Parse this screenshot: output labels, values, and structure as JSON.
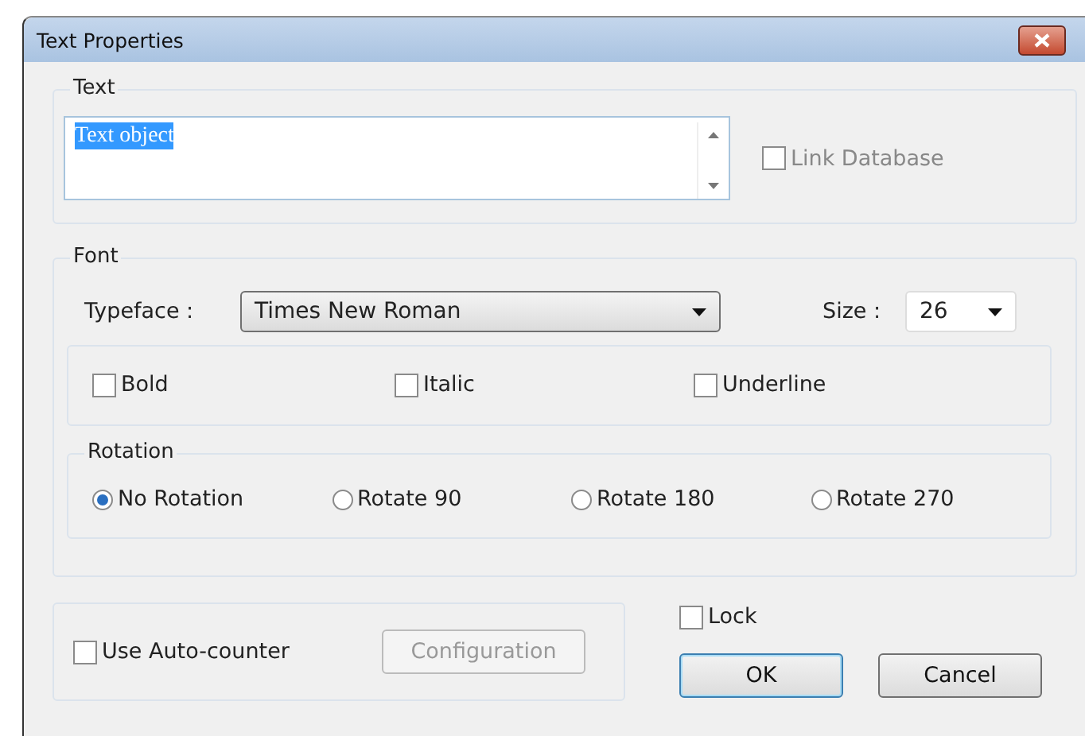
{
  "window": {
    "title": "Text Properties"
  },
  "text_group": {
    "label": "Text",
    "value": "Text object",
    "link_database": {
      "label": "Link Database",
      "checked": false,
      "disabled": true
    }
  },
  "font_group": {
    "label": "Font",
    "typeface": {
      "label": "Typeface :",
      "value": "Times New Roman"
    },
    "size": {
      "label": "Size :",
      "value": "26"
    },
    "styles": [
      {
        "label": "Bold",
        "checked": false
      },
      {
        "label": "Italic",
        "checked": false
      },
      {
        "label": "Underline",
        "checked": false
      }
    ],
    "rotation": {
      "label": "Rotation",
      "options": [
        {
          "label": "No Rotation",
          "selected": true
        },
        {
          "label": "Rotate 90",
          "selected": false
        },
        {
          "label": "Rotate 180",
          "selected": false
        },
        {
          "label": "Rotate 270",
          "selected": false
        }
      ]
    }
  },
  "auto_counter": {
    "label": "Use Auto-counter",
    "checked": false,
    "configuration": {
      "label": "Configuration",
      "disabled": true
    }
  },
  "lock": {
    "label": "Lock",
    "checked": false
  },
  "buttons": [
    {
      "label": "OK",
      "default": true
    },
    {
      "label": "Cancel",
      "default": false
    }
  ]
}
